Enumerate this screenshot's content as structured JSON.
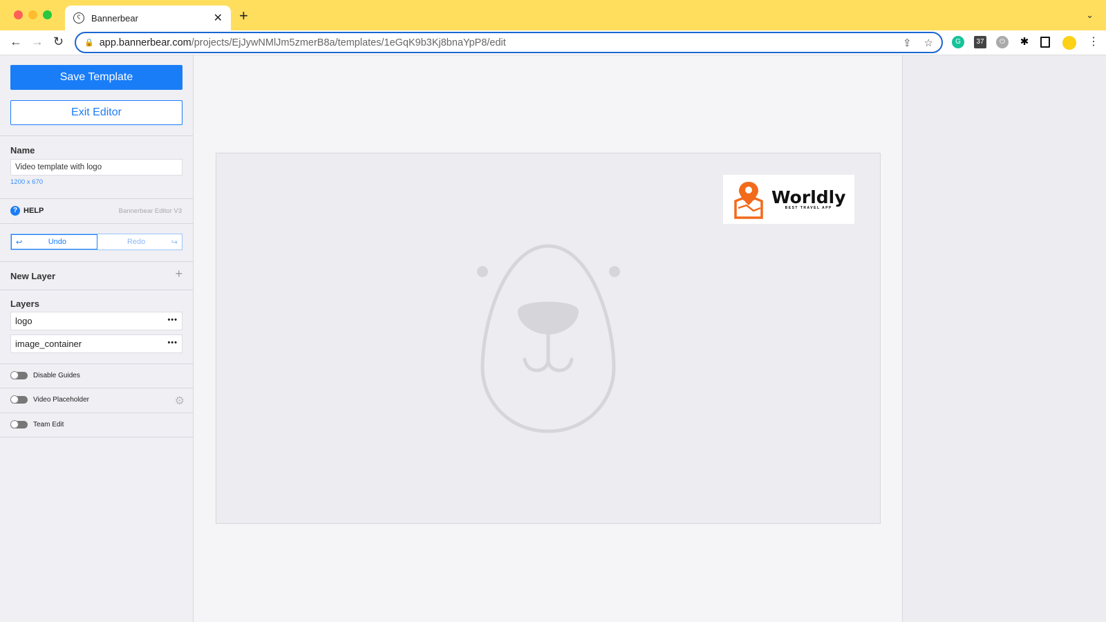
{
  "browser": {
    "tab_title": "Bannerbear",
    "url_host": "app.bannerbear.com",
    "url_path": "/projects/EjJywNMlJm5zmerB8a/templates/1eGqK9b3Kj8bnaYpP8/edit",
    "extension_badge": "37"
  },
  "sidebar": {
    "save_label": "Save Template",
    "exit_label": "Exit Editor",
    "name_label": "Name",
    "name_value": "Video template with logo",
    "dimensions": "1200 x 670",
    "help_label": "HELP",
    "version": "Bannerbear Editor V3",
    "undo_label": "Undo",
    "redo_label": "Redo",
    "new_layer_label": "New Layer",
    "layers_label": "Layers",
    "layers": [
      {
        "name": "logo"
      },
      {
        "name": "image_container"
      }
    ],
    "toggles": [
      {
        "label": "Disable Guides",
        "on": false
      },
      {
        "label": "Video Placeholder",
        "on": false
      },
      {
        "label": "Team Edit",
        "on": false
      }
    ]
  },
  "canvas": {
    "logo_text": "Worldly",
    "logo_tagline": "BEST TRAVEL APP",
    "logo_color": "#f26a1b"
  },
  "colors": {
    "accent": "#1a7df8",
    "tabbar": "#ffde5e"
  }
}
